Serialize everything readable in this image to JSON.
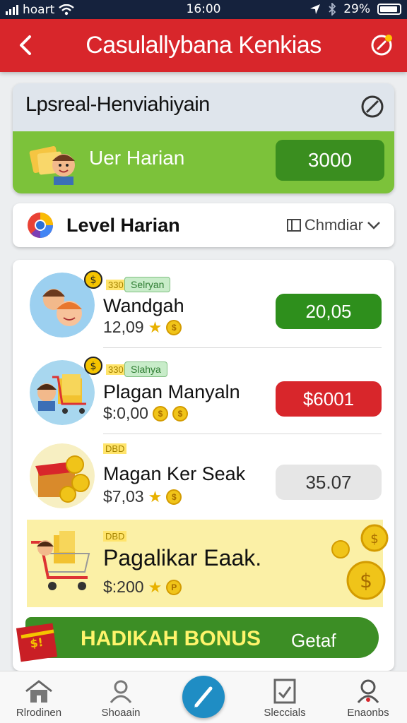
{
  "status_bar": {
    "carrier": "hoart",
    "time": "16:00",
    "battery": "29%"
  },
  "header": {
    "title": "Casulallybana Kenkias"
  },
  "summary_card": {
    "title": "Lpsreal-Henviahiyain",
    "reward_label": "Uer Harian",
    "reward_value": "3000"
  },
  "level_card": {
    "title": "Level Harian",
    "dropdown_label": "Chmdiar"
  },
  "items": [
    {
      "tag": "Selryan",
      "badge": "330",
      "name": "Wandgah",
      "price": "12,09",
      "action": "20,05",
      "action_style": "green"
    },
    {
      "tag": "Slahya",
      "badge": "330",
      "name": "Plagan Manyaln",
      "price": "$:0,00",
      "action": "$6001",
      "action_style": "red"
    },
    {
      "badge": "DBD",
      "name": "Magan Ker Seak",
      "price": "$7,03",
      "action": "35.07",
      "action_style": "gray"
    },
    {
      "badge": "DBD",
      "name": "Pagalikar Eaak.",
      "price": "$:200",
      "action": "",
      "action_style": "none"
    }
  ],
  "bonus_banner": {
    "title": "HADIKAH BONUS",
    "detail": "Getaf"
  },
  "bottom_nav": [
    {
      "label": "Rlrodinen",
      "icon": "home-icon"
    },
    {
      "label": "Shoaain",
      "icon": "person-icon"
    },
    {
      "label": "",
      "icon": "edit-icon"
    },
    {
      "label": "Sleccials",
      "icon": "checklist-icon"
    },
    {
      "label": "Enaonbs",
      "icon": "profile-icon"
    }
  ],
  "colors": {
    "header_red": "#d8262b",
    "green": "#3a8e1f",
    "light_green": "#7cc23a",
    "red_pill": "#d8262b",
    "status_bar": "#15223d",
    "accent_blue": "#1f8dc4"
  }
}
